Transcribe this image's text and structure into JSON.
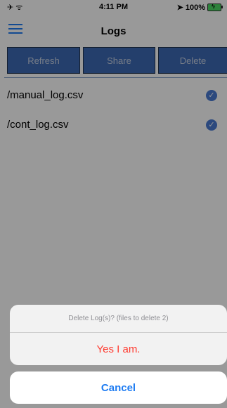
{
  "status_bar": {
    "left": "✈ ᯤ",
    "time": "4:11 PM",
    "right": "➤ 100%"
  },
  "nav": {
    "title": "Logs"
  },
  "toolbar": {
    "refresh_label": "Refresh",
    "share_label": "Share",
    "delete_label": "Delete"
  },
  "list": {
    "items": [
      {
        "name": "/manual_log.csv",
        "selected": true
      },
      {
        "name": "/cont_log.csv",
        "selected": true
      }
    ]
  },
  "action_sheet": {
    "message": "Delete Log(s)? (files to delete 2)",
    "confirm_label": "Yes I am.",
    "cancel_label": "Cancel"
  },
  "colors": {
    "accent": "#1e7cf2",
    "toolbar_button": "#3d69b4",
    "destructive": "#ff3b30",
    "checkmark": "#4a7bd3"
  }
}
